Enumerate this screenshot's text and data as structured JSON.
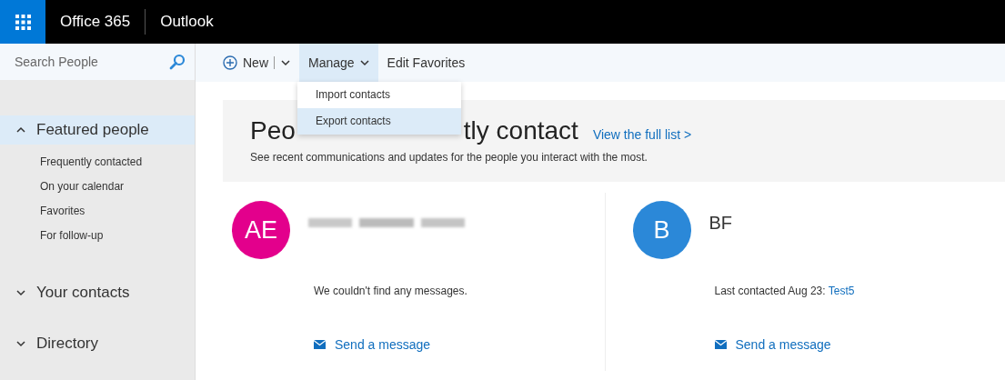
{
  "app_bar": {
    "suite": "Office 365",
    "app": "Outlook"
  },
  "search": {
    "placeholder": "Search People"
  },
  "toolbar": {
    "items": [
      {
        "label": "New",
        "kind": "split",
        "selected": false
      },
      {
        "label": "Manage",
        "kind": "menu",
        "selected": true
      },
      {
        "label": "Edit Favorites",
        "kind": "plain",
        "selected": false
      }
    ]
  },
  "menu": {
    "items": [
      {
        "label": "Import contacts",
        "selected": false
      },
      {
        "label": "Export contacts",
        "selected": true
      }
    ]
  },
  "sidebar": {
    "sections": [
      {
        "label": "Featured people",
        "expanded": true,
        "selected": true,
        "children": [
          {
            "label": "Frequently contacted"
          },
          {
            "label": "On your calendar"
          },
          {
            "label": "Favorites"
          },
          {
            "label": "For follow-up"
          }
        ]
      },
      {
        "label": "Your contacts",
        "expanded": false,
        "selected": false
      },
      {
        "label": "Directory",
        "expanded": false,
        "selected": false
      }
    ]
  },
  "banner": {
    "heading_parts": [
      "Peo",
      "tly contact"
    ],
    "link": "View the full list >",
    "subtitle": "See recent communications and updates for the people you interact with the most."
  },
  "people": [
    {
      "initials": "AE",
      "color": "#e3008c",
      "status": "We couldn't find any messages.",
      "action": "Send a message"
    },
    {
      "initials": "B",
      "color": "#2b88d8",
      "name": "BF",
      "status": "Last contacted Aug 23: ",
      "status_link": "Test5",
      "action": "Send a message"
    }
  ]
}
